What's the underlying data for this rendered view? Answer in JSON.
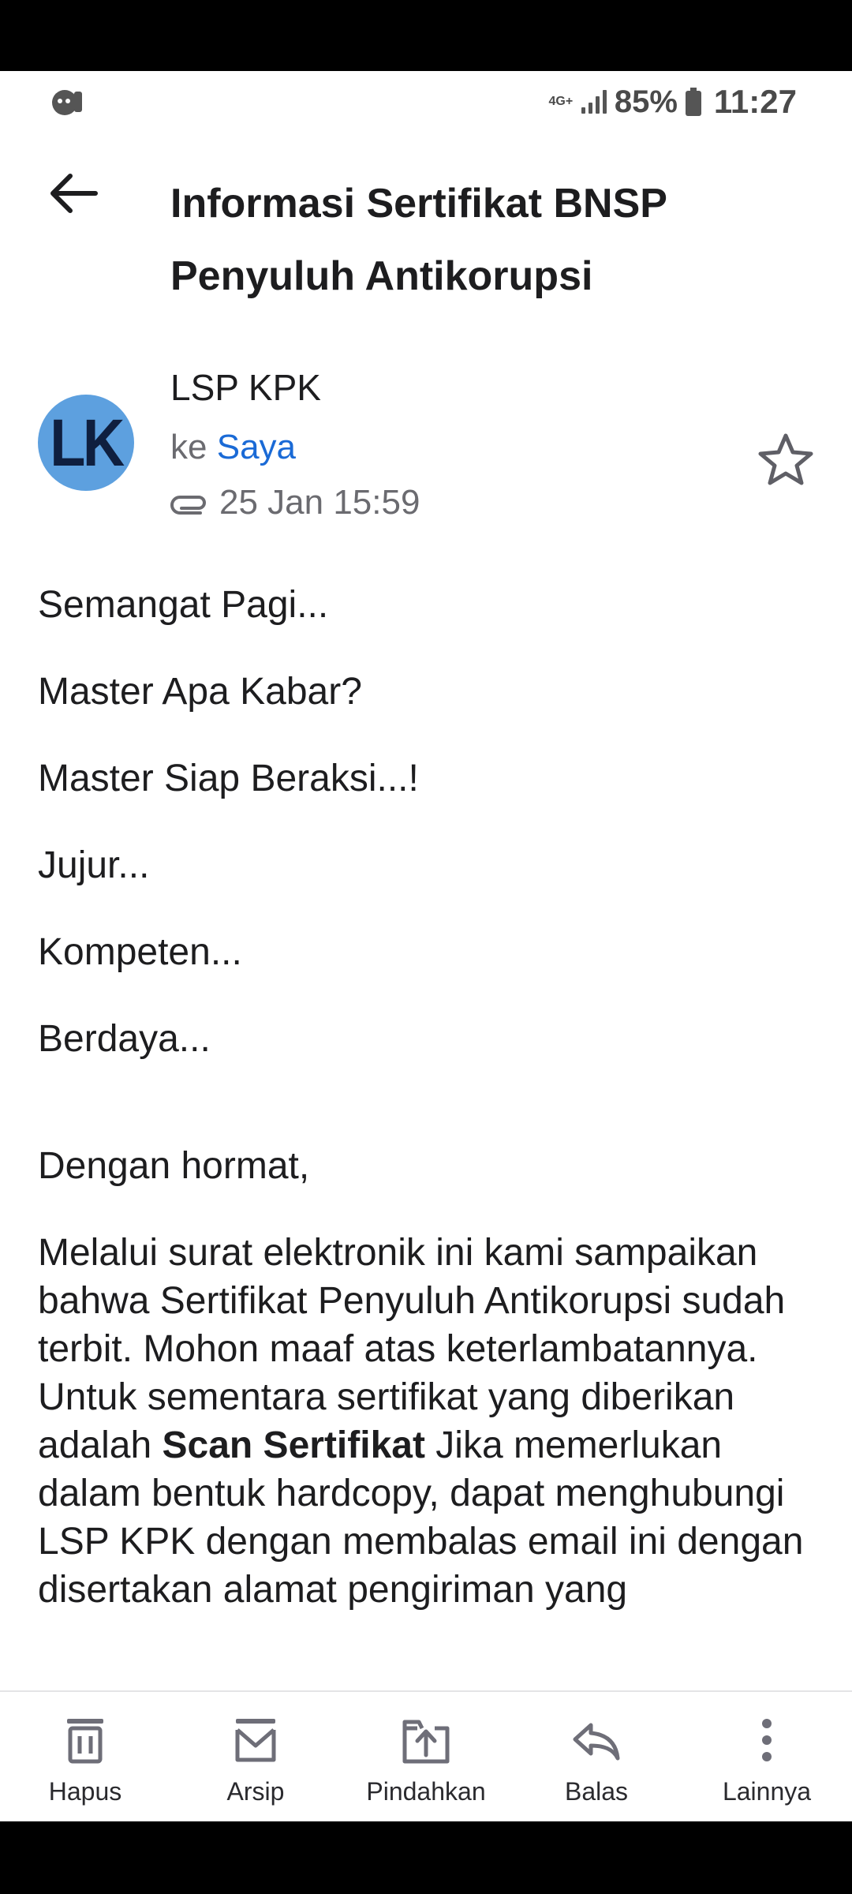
{
  "status_bar": {
    "network": "4G+",
    "battery_pct": "85%",
    "time": "11:27",
    "icons": [
      "notification-app-icon",
      "signal-icon",
      "battery-icon"
    ]
  },
  "header": {
    "back_icon": "arrow-left-icon",
    "subject": "Informasi Sertifikat BNSP Penyuluh Antikorupsi"
  },
  "sender": {
    "avatar_initials": "LK",
    "avatar_color": "#5da0df",
    "name": "LSP KPK",
    "to_prefix": "ke",
    "to_name": "Saya",
    "date": "25 Jan 15:59",
    "attachment_icon": "paperclip-icon",
    "star_icon": "star-outline-icon"
  },
  "body": {
    "lines": [
      "Semangat Pagi...",
      "Master Apa Kabar?",
      "Master Siap Beraksi...!",
      "Jujur...",
      "Kompeten...",
      "Berdaya..."
    ],
    "salutation": "Dengan hormat,",
    "paragraph": {
      "part1": "Melalui surat elektronik ini kami sampaikan bahwa Sertifikat Penyuluh Antikorupsi sudah terbit. Mohon maaf atas keterlambatannya. Untuk sementara sertifikat yang diberikan adalah ",
      "bold": "Scan Sertifikat",
      "part2": " Jika memerlukan dalam bentuk hardcopy, dapat menghubungi LSP KPK dengan membalas email ini dengan disertakan alamat pengiriman yang"
    }
  },
  "toolbar": {
    "items": [
      {
        "label": "Hapus",
        "icon": "trash-icon"
      },
      {
        "label": "Arsip",
        "icon": "archive-icon"
      },
      {
        "label": "Pindahkan",
        "icon": "move-folder-icon"
      },
      {
        "label": "Balas",
        "icon": "reply-icon"
      },
      {
        "label": "Lainnya",
        "icon": "more-vertical-icon"
      }
    ]
  },
  "colors": {
    "link": "#1a6ad6",
    "icon": "#6e6e78",
    "text": "#1d1d1f"
  }
}
